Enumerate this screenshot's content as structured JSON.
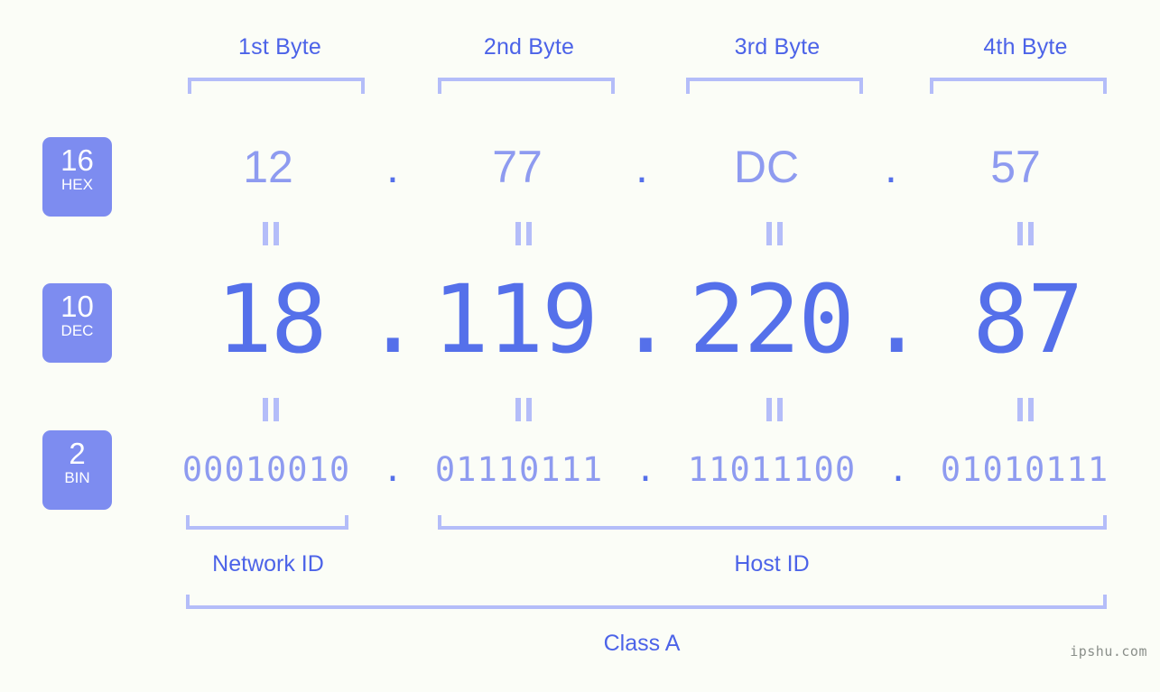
{
  "background_color": "#fbfdf7",
  "accent_color": "#5570ea",
  "accent_light_color": "#8e9bf0",
  "bracket_color": "#b4bdf9",
  "badge_bg_color": "#7d8cf0",
  "header": {
    "byte_labels": [
      "1st Byte",
      "2nd Byte",
      "3rd Byte",
      "4th Byte"
    ]
  },
  "bases": [
    {
      "number": "16",
      "name": "HEX"
    },
    {
      "number": "10",
      "name": "DEC"
    },
    {
      "number": "2",
      "name": "BIN"
    }
  ],
  "separator": ".",
  "rows": {
    "hex": {
      "base_number": "16",
      "base_name": "HEX",
      "values": [
        "12",
        "77",
        "DC",
        "57"
      ]
    },
    "dec": {
      "base_number": "10",
      "base_name": "DEC",
      "values": [
        "18",
        "119",
        "220",
        "87"
      ]
    },
    "bin": {
      "base_number": "2",
      "base_name": "BIN",
      "values": [
        "00010010",
        "01110111",
        "11011100",
        "01010111"
      ]
    }
  },
  "equality_marks": {
    "symbol": "=",
    "hex_to_dec_count": 4,
    "dec_to_bin_count": 4
  },
  "sections": {
    "network_id": "Network ID",
    "host_id": "Host ID",
    "class": "Class A"
  },
  "watermark": "ipshu.com"
}
